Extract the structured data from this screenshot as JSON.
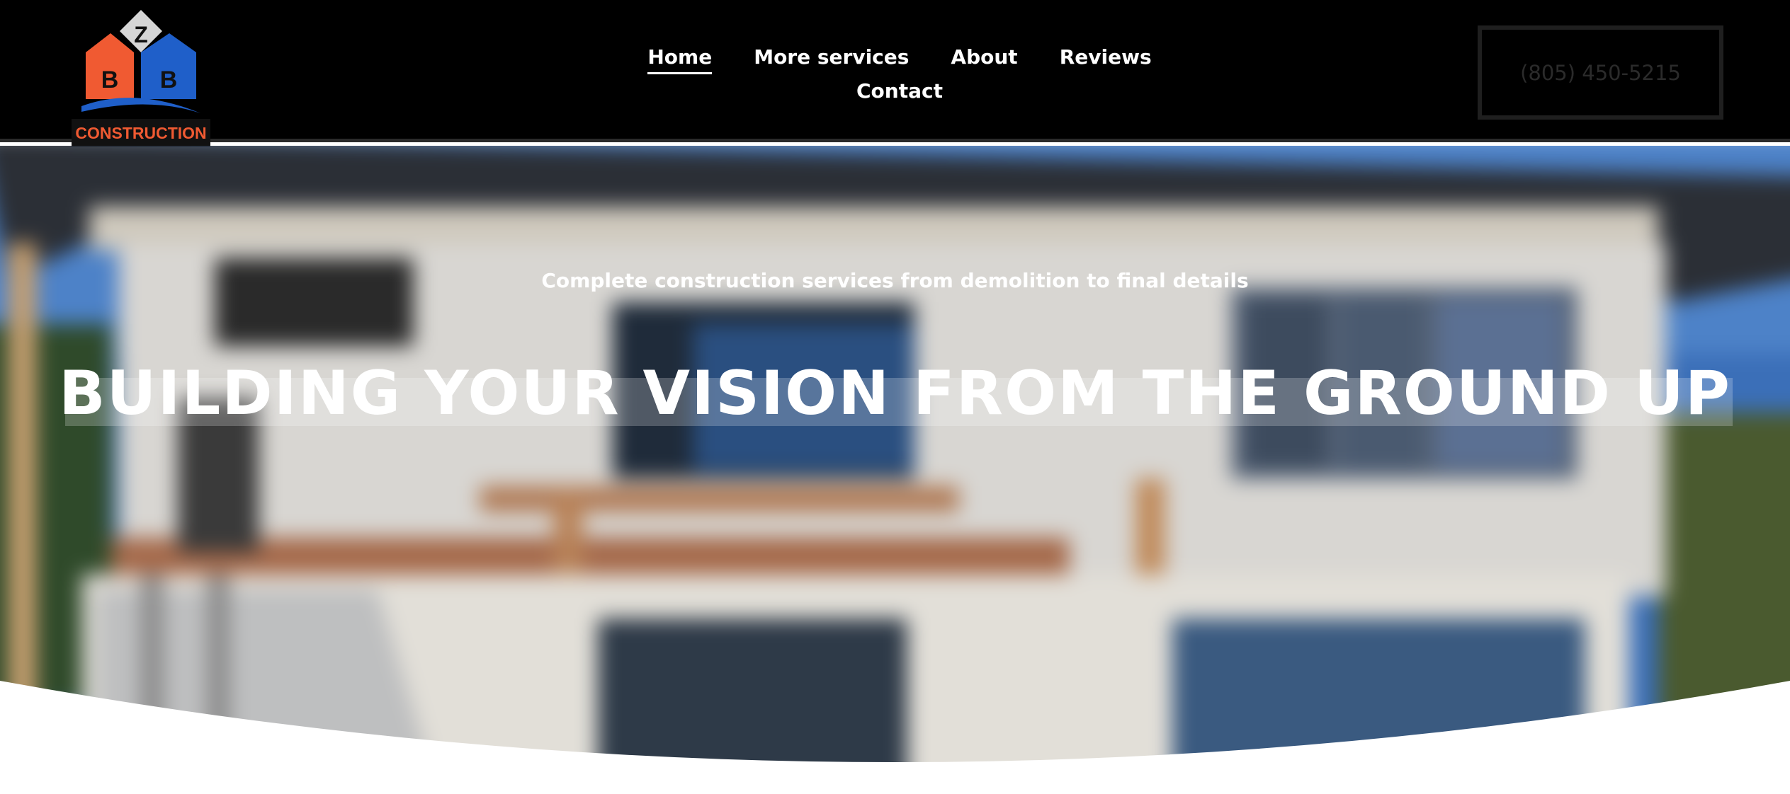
{
  "brand": {
    "logo_text": "CONSTRUCTION",
    "logo_letters": [
      "Z",
      "B",
      "B"
    ],
    "colors": {
      "orange": "#f05a32",
      "blue": "#1f5fc9",
      "grey": "#d9d9d9"
    }
  },
  "nav": {
    "items": [
      {
        "label": "Home",
        "active": true
      },
      {
        "label": "More services",
        "active": false
      },
      {
        "label": "About",
        "active": false
      },
      {
        "label": "Reviews",
        "active": false
      },
      {
        "label": "Contact",
        "active": false
      }
    ]
  },
  "header": {
    "phone": "(805) 450-5215"
  },
  "hero": {
    "subtitle": "Complete construction services from demolition to final details",
    "title": "BUILDING YOUR VISION FROM THE GROUND UP"
  }
}
